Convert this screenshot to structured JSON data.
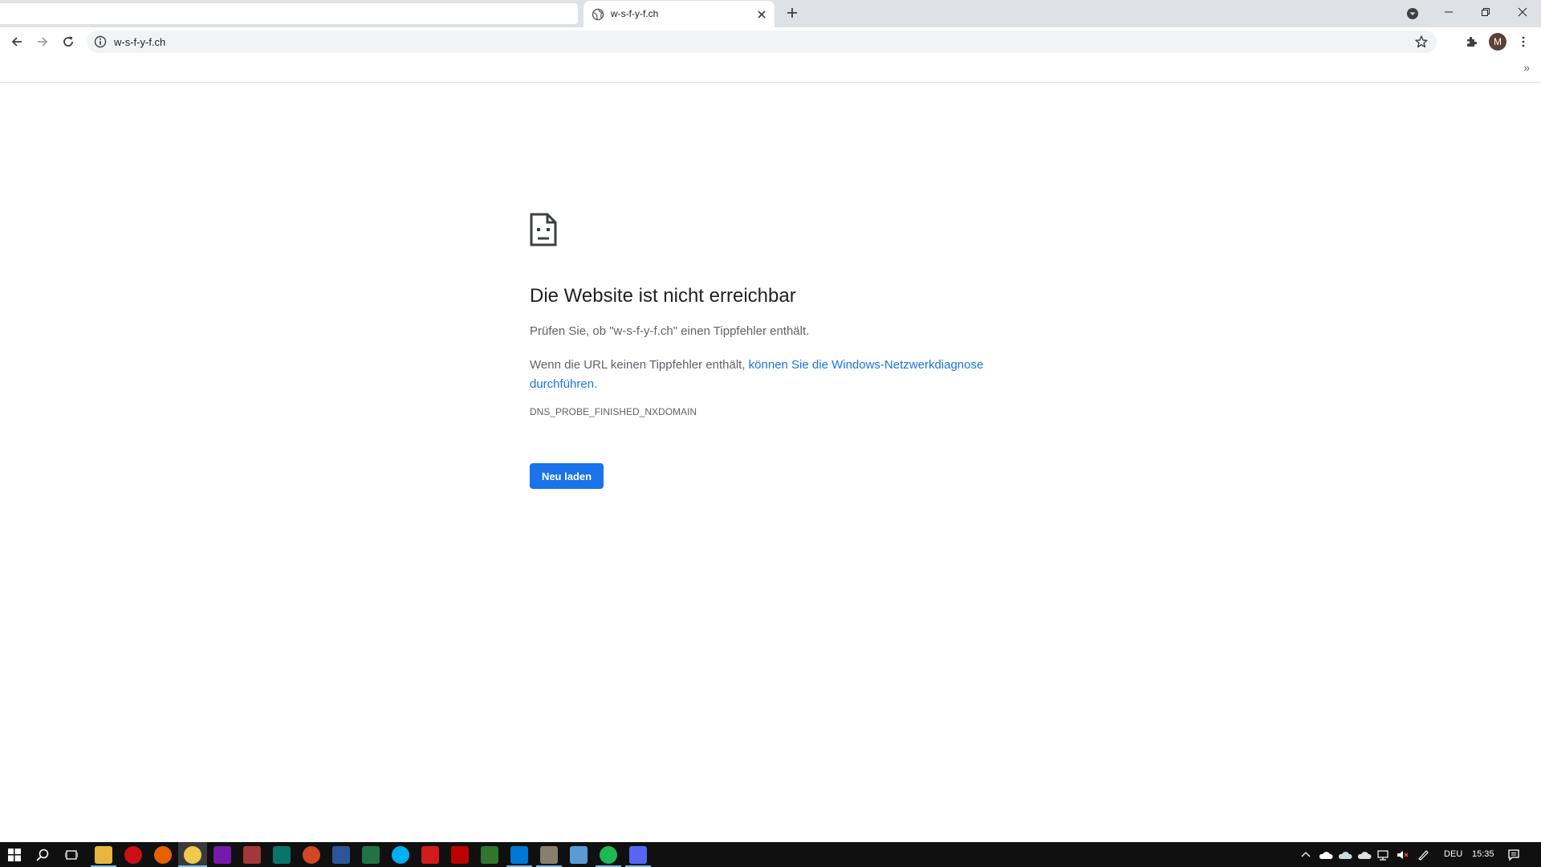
{
  "browser": {
    "tab": {
      "title": "w-s-f-y-f.ch"
    },
    "address_bar": {
      "url": "w-s-f-y-f.ch"
    },
    "profile_initial": "M",
    "bookmarks_overflow": "»"
  },
  "error_page": {
    "heading": "Die Website ist nicht erreichbar",
    "line1": "Prüfen Sie, ob \"w-s-f-y-f.ch\" einen Tippfehler enthält.",
    "line2_prefix": "Wenn die URL keinen Tippfehler enthält, ",
    "line2_link": "können Sie die Windows-Netzwerkdiagnose durchführen",
    "line2_suffix": ".",
    "error_code": "DNS_PROBE_FINISHED_NXDOMAIN",
    "reload_button": "Neu laden"
  },
  "taskbar": {
    "language": "DEU",
    "time": "15:35",
    "apps": [
      "start-icon",
      "search-icon",
      "task-view-icon",
      "file-explorer-icon",
      "opera-icon",
      "firefox-icon",
      "chrome-icon",
      "onenote-icon",
      "access-icon",
      "publisher-icon",
      "powerpoint-icon",
      "word-icon",
      "excel-icon",
      "skype-icon",
      "acrobat-icon",
      "filezilla-icon",
      "project-icon",
      "outlook-icon",
      "gimp-icon",
      "notepad-icon",
      "spotify-icon",
      "discord-icon"
    ]
  },
  "colors": {
    "accent": "#1a73e8",
    "tabstrip": "#dee1e6",
    "taskbar": "#101010"
  }
}
